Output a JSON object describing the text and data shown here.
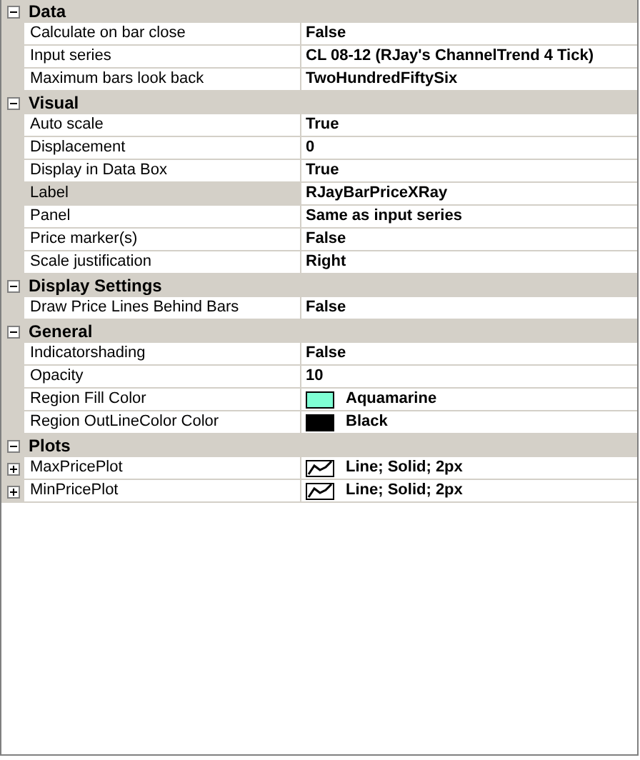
{
  "categories": [
    {
      "name": "Data",
      "expanded": true,
      "properties": [
        {
          "kind": "text",
          "name": "Calculate on bar close",
          "value": "False",
          "selected": false
        },
        {
          "kind": "text",
          "name": "Input series",
          "value": "CL 08-12 (RJay's ChannelTrend  4 Tick)",
          "selected": false
        },
        {
          "kind": "text",
          "name": "Maximum bars look back",
          "value": "TwoHundredFiftySix",
          "selected": false
        }
      ]
    },
    {
      "name": "Visual",
      "expanded": true,
      "properties": [
        {
          "kind": "text",
          "name": "Auto scale",
          "value": "True",
          "selected": false
        },
        {
          "kind": "text",
          "name": "Displacement",
          "value": "0",
          "selected": false
        },
        {
          "kind": "text",
          "name": "Display in Data Box",
          "value": "True",
          "selected": false
        },
        {
          "kind": "text",
          "name": "Label",
          "value": "RJayBarPriceXRay",
          "selected": true
        },
        {
          "kind": "text",
          "name": "Panel",
          "value": "Same as input series",
          "selected": false
        },
        {
          "kind": "text",
          "name": "Price marker(s)",
          "value": "False",
          "selected": false
        },
        {
          "kind": "text",
          "name": "Scale justification",
          "value": "Right",
          "selected": false
        }
      ]
    },
    {
      "name": "Display Settings",
      "expanded": true,
      "properties": [
        {
          "kind": "text",
          "name": "Draw Price Lines Behind Bars",
          "value": "False",
          "selected": false
        }
      ]
    },
    {
      "name": "General",
      "expanded": true,
      "properties": [
        {
          "kind": "text",
          "name": "Indicatorshading",
          "value": "False",
          "selected": false
        },
        {
          "kind": "text",
          "name": "Opacity",
          "value": "10",
          "selected": false
        },
        {
          "kind": "color",
          "name": "Region Fill Color",
          "value": "Aquamarine",
          "color": "#7fffd4",
          "selected": false
        },
        {
          "kind": "color",
          "name": "Region OutLineColor Color",
          "value": "Black",
          "color": "#000000",
          "selected": false
        }
      ]
    },
    {
      "name": "Plots",
      "expanded": true,
      "properties": [
        {
          "kind": "plot",
          "name": "MaxPricePlot",
          "value": "Line; Solid; 2px",
          "expanded": false,
          "selected": false
        },
        {
          "kind": "plot",
          "name": "MinPricePlot",
          "value": "Line; Solid; 2px",
          "expanded": false,
          "selected": false
        }
      ]
    }
  ]
}
